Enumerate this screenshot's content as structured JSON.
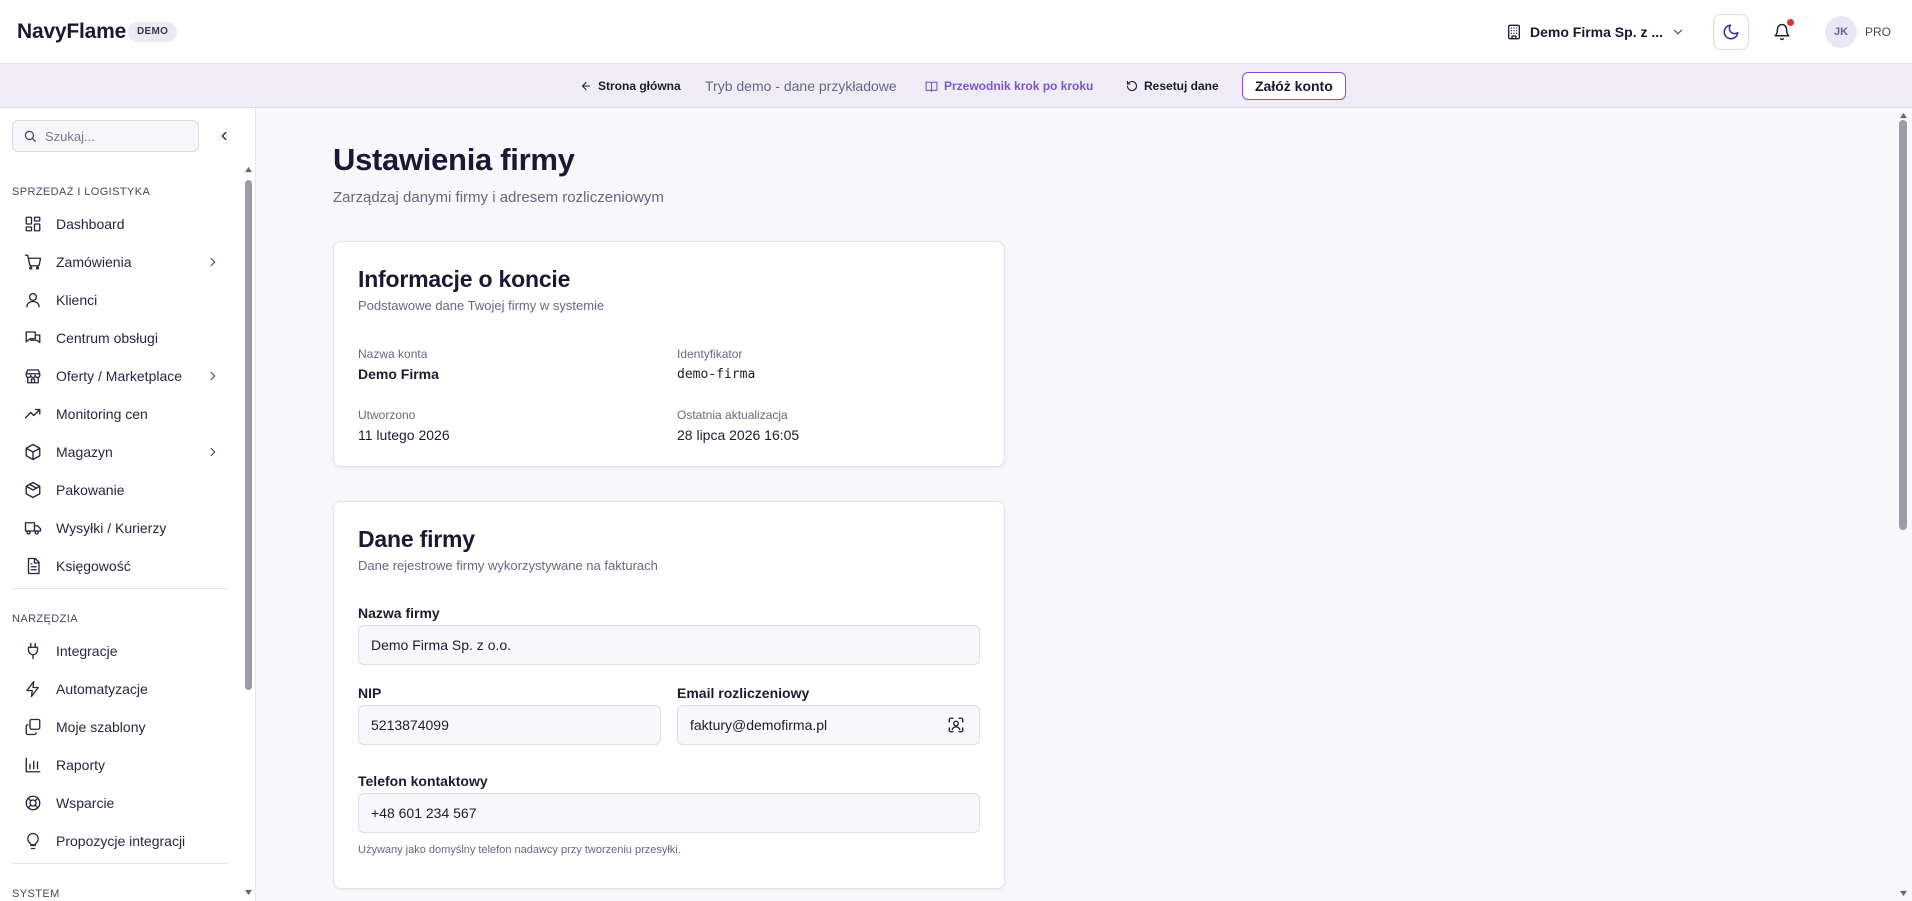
{
  "header": {
    "brand": "NavyFlame",
    "badge": "DEMO",
    "company": "Demo Firma Sp. z ...",
    "avatar_initials": "JK",
    "plan": "PRO",
    "notification_dot_color": "#e0312f"
  },
  "demobar": {
    "home": "Strona główna",
    "mode": "Tryb demo - dane przykładowe",
    "guide": "Przewodnik krok po kroku",
    "reset": "Resetuj dane",
    "signup": "Załóż konto",
    "accent": "#8a4fd1"
  },
  "sidebar": {
    "search_placeholder": "Szukaj...",
    "sections": [
      {
        "title": "SPRZEDAŻ I LOGISTYKA",
        "items": [
          {
            "label": "Dashboard",
            "icon": "dashboard-icon"
          },
          {
            "label": "Zamówienia",
            "icon": "cart-icon",
            "submenu": true
          },
          {
            "label": "Klienci",
            "icon": "user-icon"
          },
          {
            "label": "Centrum obsługi",
            "icon": "chat-icon"
          },
          {
            "label": "Oferty / Marketplace",
            "icon": "store-icon",
            "submenu": true
          },
          {
            "label": "Monitoring cen",
            "icon": "trend-icon"
          },
          {
            "label": "Magazyn",
            "icon": "package-icon",
            "submenu": true
          },
          {
            "label": "Pakowanie",
            "icon": "box-icon"
          },
          {
            "label": "Wysyłki / Kurierzy",
            "icon": "truck-icon"
          },
          {
            "label": "Księgowość",
            "icon": "document-icon"
          }
        ]
      },
      {
        "title": "NARZĘDZIA",
        "items": [
          {
            "label": "Integracje",
            "icon": "plug-icon"
          },
          {
            "label": "Automatyzacje",
            "icon": "bolt-icon"
          },
          {
            "label": "Moje szablony",
            "icon": "templates-icon"
          },
          {
            "label": "Raporty",
            "icon": "chart-icon"
          },
          {
            "label": "Wsparcie",
            "icon": "lifebuoy-icon"
          },
          {
            "label": "Propozycje integracji",
            "icon": "lightbulb-icon"
          }
        ]
      },
      {
        "title": "SYSTEM",
        "items": []
      }
    ]
  },
  "page": {
    "title": "Ustawienia firmy",
    "subtitle": "Zarządzaj danymi firmy i adresem rozliczeniowym"
  },
  "account_card": {
    "title": "Informacje o koncie",
    "description": "Podstawowe dane Twojej firmy w systemie",
    "fields": [
      {
        "label": "Nazwa konta",
        "value": "Demo Firma"
      },
      {
        "label": "Identyfikator",
        "value": "demo-firma"
      },
      {
        "label": "Utworzono",
        "value": "11 lutego 2026"
      },
      {
        "label": "Ostatnia aktualizacja",
        "value": "28 lipca 2026 16:05"
      }
    ]
  },
  "company_card": {
    "title": "Dane firmy",
    "description": "Dane rejestrowe firmy wykorzystywane na fakturach",
    "company_name_label": "Nazwa firmy",
    "company_name_value": "Demo Firma Sp. z o.o.",
    "nip_label": "NIP",
    "nip_value": "5213874099",
    "email_label": "Email rozliczeniowy",
    "email_value": "faktury@demofirma.pl",
    "phone_label": "Telefon kontaktowy",
    "phone_value": "+48 601 234 567",
    "phone_hint": "Używany jako domyślny telefon nadawcy przy tworzeniu przesyłki."
  }
}
